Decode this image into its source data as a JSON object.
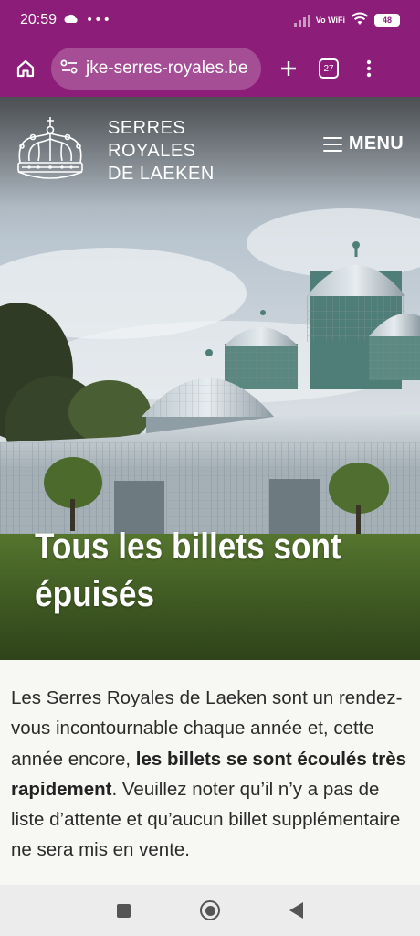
{
  "status_bar": {
    "time": "20:59",
    "network_label": "Vo WiFi",
    "battery": "48"
  },
  "browser": {
    "url": "jke-serres-royales.be",
    "tab_count": "27"
  },
  "site": {
    "logo_lines": [
      "SERRES",
      "ROYALES",
      "DE LAEKEN"
    ],
    "menu_label": "MENU"
  },
  "hero": {
    "title": "Tous les billets sont épuisés"
  },
  "content": {
    "text_before": "Les Serres Royales de Laeken sont un rendez-vous incontournable chaque année et, cette année encore, ",
    "text_bold": "les billets se sont écoulés très rapidement",
    "text_after": ". Veuillez noter qu’il n’y a pas de liste d’attente et qu’aucun billet supplémentaire ne sera mis en vente."
  },
  "colors": {
    "browser_bar": "#8c1d79",
    "page_background": "#f7f7f3"
  },
  "icons": [
    "cloud-icon",
    "more-dots-icon",
    "signal-icon",
    "wifi-icon",
    "battery-icon",
    "home-icon",
    "site-settings-icon",
    "new-tab-icon",
    "tab-switcher-icon",
    "overflow-menu-icon",
    "crown-logo-icon",
    "hamburger-icon",
    "recents-nav-icon",
    "home-nav-icon",
    "back-nav-icon"
  ]
}
